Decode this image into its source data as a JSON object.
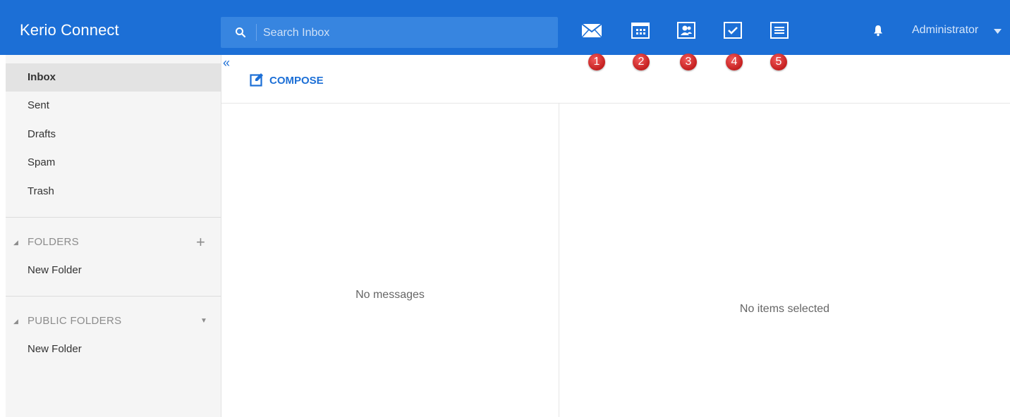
{
  "header": {
    "brand": "Kerio Connect",
    "search_placeholder": "Search Inbox",
    "user": "Administrator",
    "app_icons": [
      {
        "name": "mail-icon",
        "badge": "1"
      },
      {
        "name": "calendar-icon",
        "badge": "2"
      },
      {
        "name": "contacts-icon",
        "badge": "3"
      },
      {
        "name": "tasks-icon",
        "badge": "4"
      },
      {
        "name": "notes-icon",
        "badge": "5"
      }
    ],
    "colors": {
      "bar": "#1c6fd6",
      "badge": "#d62b2b"
    }
  },
  "sidebar": {
    "items": [
      {
        "label": "Inbox",
        "active": true
      },
      {
        "label": "Sent"
      },
      {
        "label": "Drafts"
      },
      {
        "label": "Spam"
      },
      {
        "label": "Trash"
      }
    ],
    "folders": {
      "title": "FOLDERS",
      "items": [
        "New Folder"
      ]
    },
    "public_folders": {
      "title": "PUBLIC FOLDERS",
      "items": [
        "New Folder"
      ]
    }
  },
  "toolbar": {
    "collapse": "«",
    "compose": "COMPOSE"
  },
  "list": {
    "empty": "No messages"
  },
  "preview": {
    "empty": "No items selected"
  }
}
